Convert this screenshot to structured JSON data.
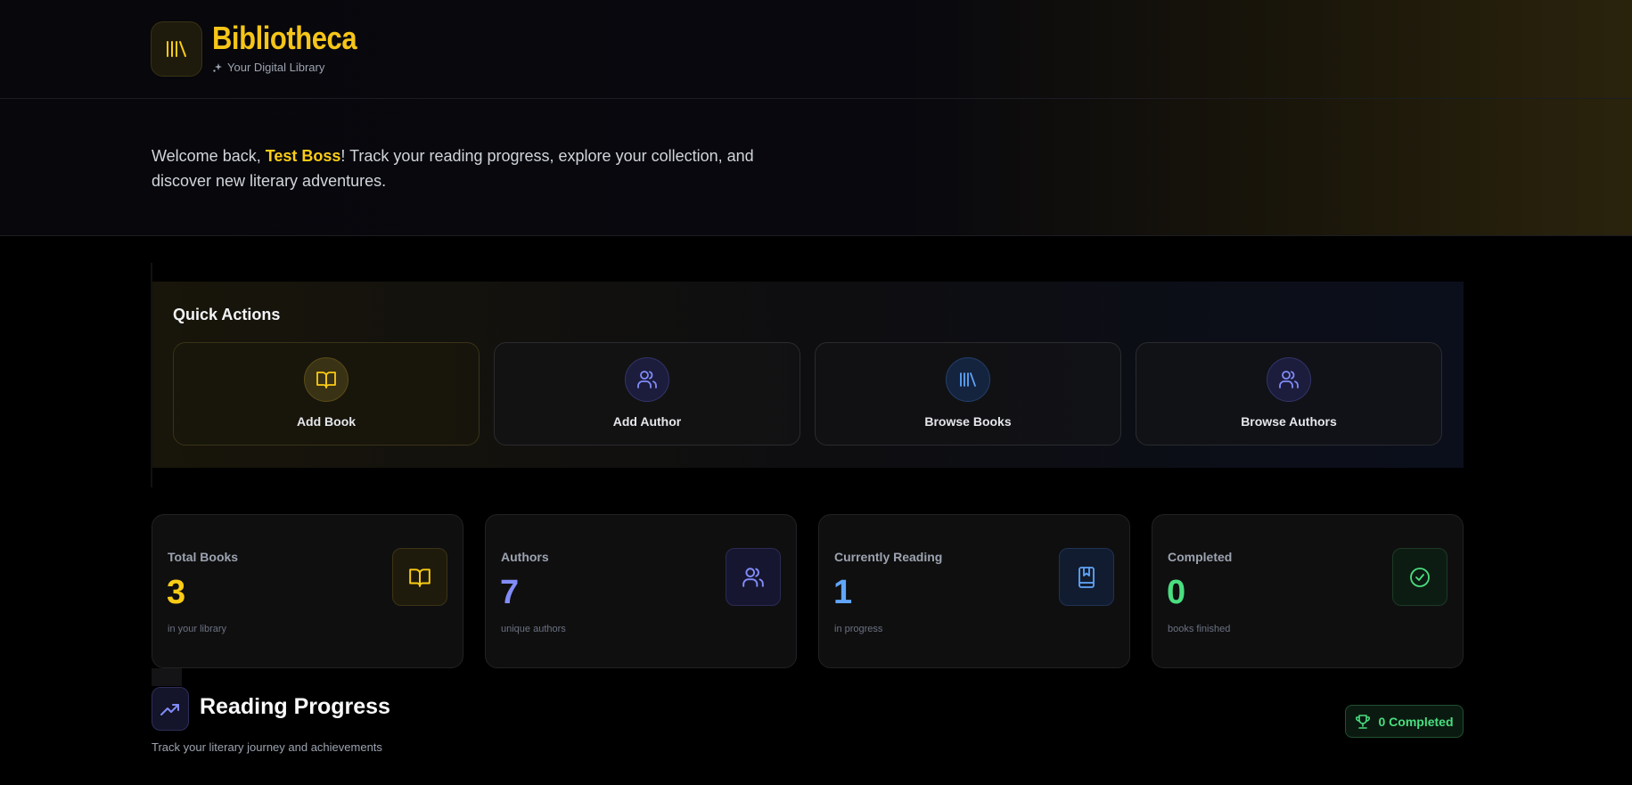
{
  "brand": {
    "title": "Bibliotheca",
    "subtitle": "Your Digital Library",
    "logo_icon": "library-icon",
    "accent": "#f5c518"
  },
  "welcome": {
    "prefix": "Welcome back, ",
    "user_name": "Test Boss",
    "suffix": "! Track your reading progress, explore your collection, and discover new literary adventures."
  },
  "quick_actions": {
    "title": "Quick Actions",
    "items": [
      {
        "label": "Add Book",
        "icon": "book-open-icon",
        "color": "#facc15"
      },
      {
        "label": "Add Author",
        "icon": "users-icon",
        "color": "#818cf8"
      },
      {
        "label": "Browse Books",
        "icon": "library-icon",
        "color": "#60a5fa"
      },
      {
        "label": "Browse Authors",
        "icon": "users-icon",
        "color": "#818cf8"
      }
    ]
  },
  "stats": [
    {
      "label": "Total Books",
      "value": "3",
      "sub": "in your library",
      "icon": "book-open-icon",
      "color": "#facc15"
    },
    {
      "label": "Authors",
      "value": "7",
      "sub": "unique authors",
      "icon": "users-icon",
      "color": "#818cf8"
    },
    {
      "label": "Currently Reading",
      "value": "1",
      "sub": "in progress",
      "icon": "bookmark-book-icon",
      "color": "#60a5fa"
    },
    {
      "label": "Completed",
      "value": "0",
      "sub": "books finished",
      "icon": "check-circle-icon",
      "color": "#4ade80"
    }
  ],
  "reading_progress": {
    "title": "Reading Progress",
    "subtitle": "Track your literary journey and achievements",
    "badge": "0 Completed",
    "icon": "trending-up-icon",
    "badge_icon": "trophy-icon"
  }
}
